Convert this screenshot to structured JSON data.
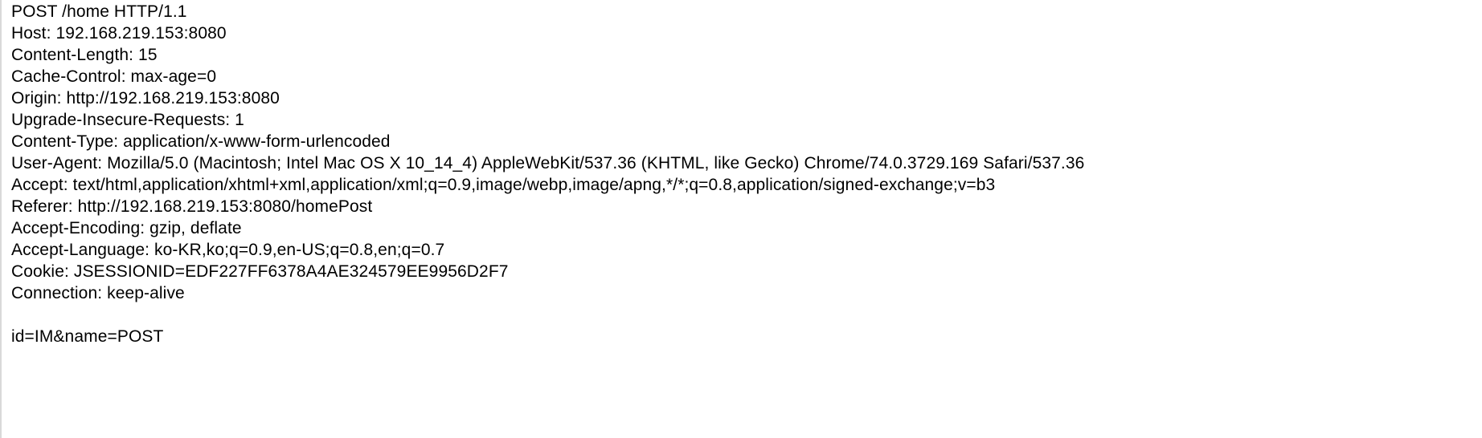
{
  "request": {
    "request_line": "POST /home HTTP/1.1",
    "headers": [
      "Host: 192.168.219.153:8080",
      "Content-Length: 15",
      "Cache-Control: max-age=0",
      "Origin: http://192.168.219.153:8080",
      "Upgrade-Insecure-Requests: 1",
      "Content-Type: application/x-www-form-urlencoded",
      "User-Agent: Mozilla/5.0 (Macintosh; Intel Mac OS X 10_14_4) AppleWebKit/537.36 (KHTML, like Gecko) Chrome/74.0.3729.169 Safari/537.36",
      "Accept: text/html,application/xhtml+xml,application/xml;q=0.9,image/webp,image/apng,*/*;q=0.8,application/signed-exchange;v=b3",
      "Referer: http://192.168.219.153:8080/homePost",
      "Accept-Encoding: gzip, deflate",
      "Accept-Language: ko-KR,ko;q=0.9,en-US;q=0.8,en;q=0.7",
      "Cookie: JSESSIONID=EDF227FF6378A4AE324579EE9956D2F7",
      "Connection: keep-alive"
    ],
    "body": "id=IM&name=POST"
  }
}
